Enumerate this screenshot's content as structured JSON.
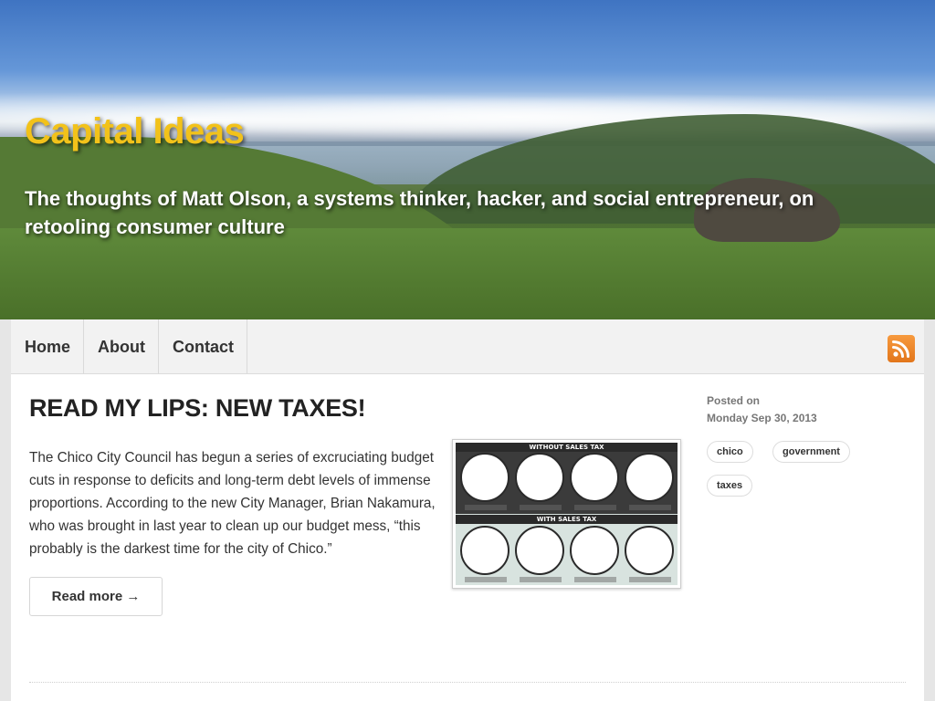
{
  "header": {
    "site_title": "Capital Ideas",
    "tagline": "The thoughts of Matt Olson, a systems thinker, hacker, and social entrepreneur, on retooling consumer culture",
    "title_color": "#f2c21a"
  },
  "nav": {
    "items": [
      {
        "label": "Home"
      },
      {
        "label": "About"
      },
      {
        "label": "Contact"
      }
    ],
    "rss_icon": "rss-feed-icon",
    "rss_color": "#f08a2a"
  },
  "post": {
    "title": "READ MY LIPS: NEW TAXES!",
    "excerpt": "The Chico City Council has begun a series of excruciating budget cuts in response to deficits and long-term debt levels of immense proportions. According to the new City Manager, Brian Nakamura, who was brought in last year to clean up our budget mess, “this probably is the darkest time for the city of Chico.”",
    "read_more": "Read more →",
    "infographic": {
      "top_label": "WITHOUT SALES TAX",
      "bottom_label": "WITH SALES TAX"
    },
    "meta": {
      "posted_label": "Posted on",
      "date": "Monday Sep 30, 2013",
      "tags": [
        "chico",
        "government",
        "taxes"
      ]
    }
  }
}
